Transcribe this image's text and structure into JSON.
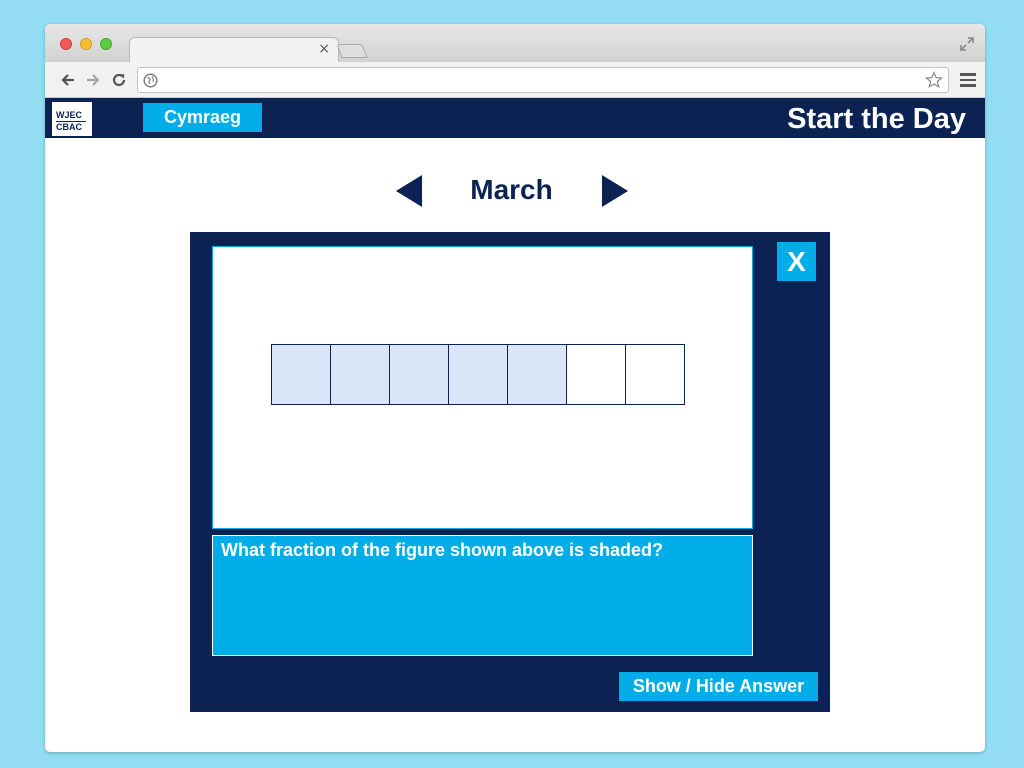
{
  "browser": {
    "tab_close": "×",
    "address": {
      "value": "",
      "placeholder": ""
    }
  },
  "site": {
    "logo": {
      "line1": "WJEC",
      "line2": "CBAC"
    },
    "language_button": "Cymraeg",
    "title": "Start the Day"
  },
  "month_nav": {
    "month": "March"
  },
  "activity": {
    "close_label": "X",
    "figure": {
      "total_cells": 7,
      "shaded_cells": 5
    },
    "question": "What fraction of the figure shown above is shaded?",
    "answer_button": "Show / Hide Answer"
  },
  "colors": {
    "navy": "#0b2253",
    "accent": "#00ade9",
    "shaded_cell": "#dae5f7",
    "page_background": "#93dcf2"
  },
  "icons": {
    "browser": [
      "close-icon",
      "fullscreen-icon",
      "back-icon",
      "forward-icon",
      "reload-icon",
      "globe-icon",
      "star-icon",
      "menu-icon"
    ],
    "month_nav": [
      "arrow-left-icon",
      "arrow-right-icon"
    ]
  }
}
